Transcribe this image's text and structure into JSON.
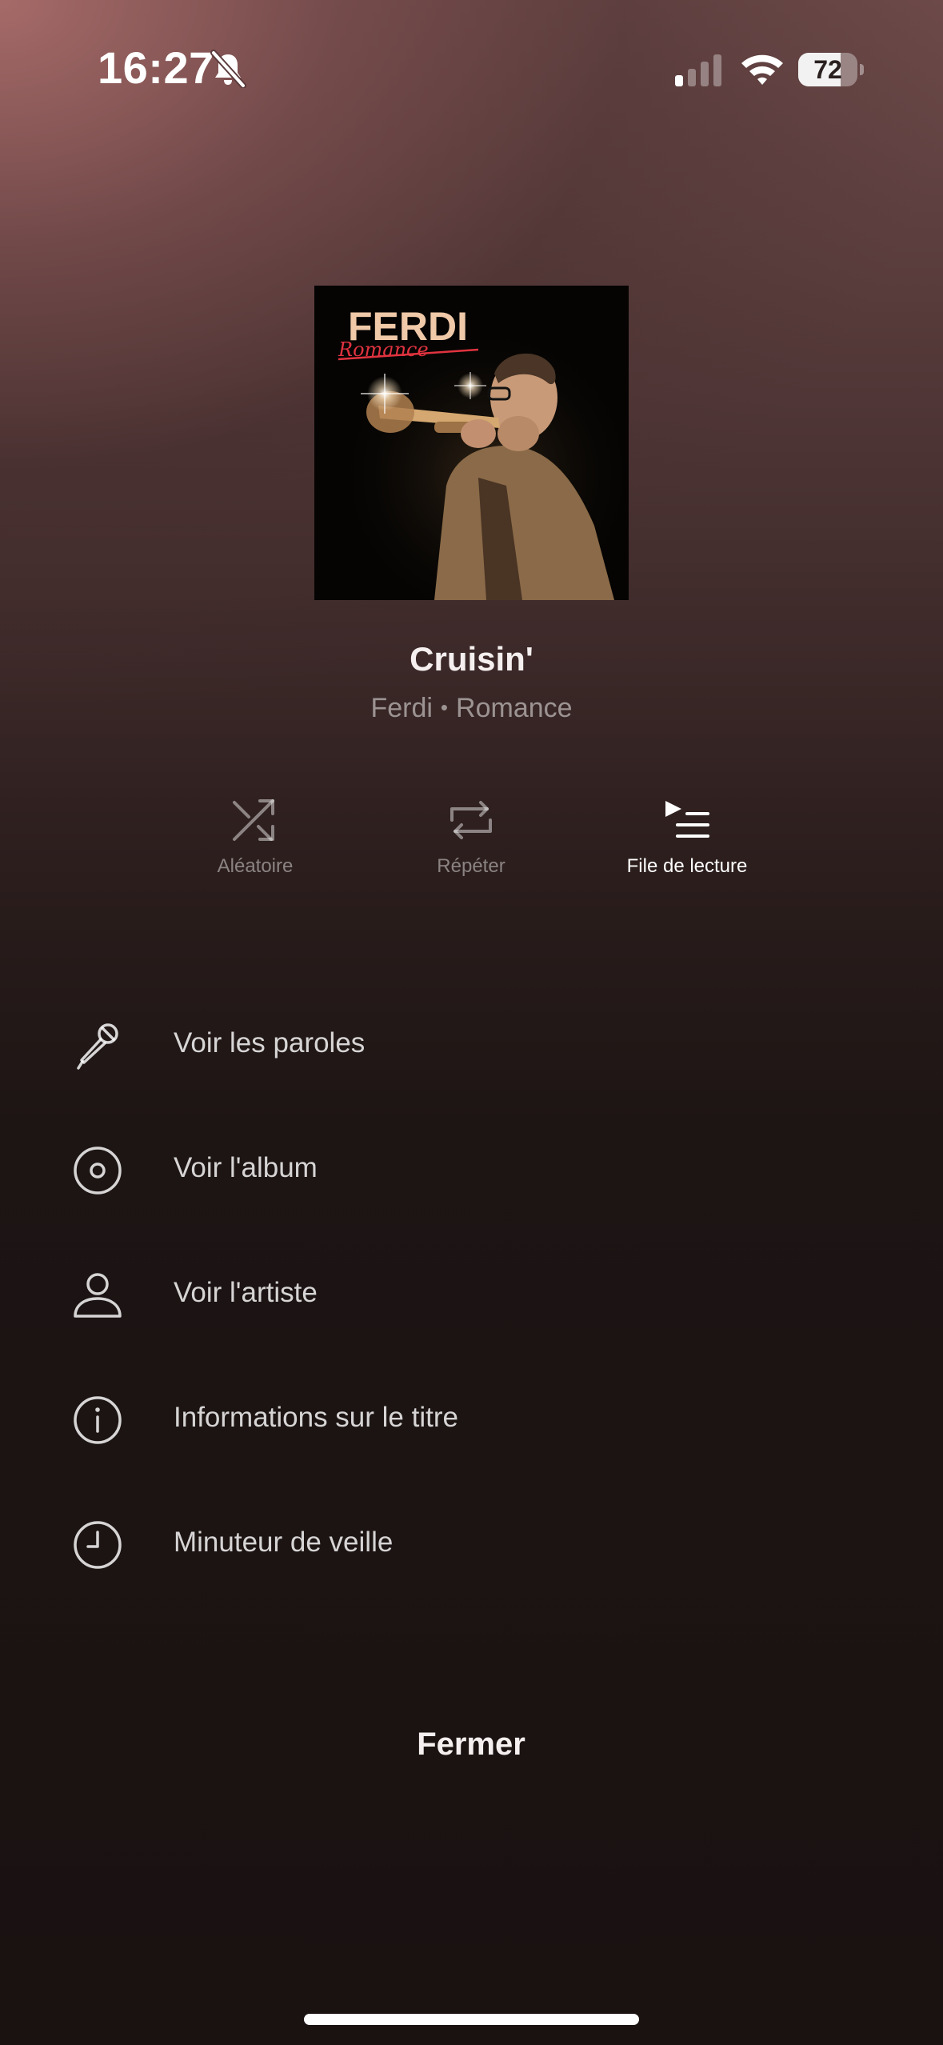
{
  "status_bar": {
    "time": "16:27",
    "battery_level": "72",
    "battery_fraction": 0.72,
    "icons": [
      "bell-slash-icon",
      "cellular-signal-icon",
      "wifi-icon",
      "battery-icon"
    ]
  },
  "now_playing": {
    "album_cover_text": "FERDI",
    "album_cover_script": "Romance",
    "title": "Cruisin'",
    "artist": "Ferdi",
    "separator": "•",
    "album": "Romance"
  },
  "playback_options": [
    {
      "label": "Aléatoire",
      "icon": "shuffle-icon",
      "active": false
    },
    {
      "label": "Répéter",
      "icon": "repeat-icon",
      "active": false
    },
    {
      "label": "File de lecture",
      "icon": "queue-icon",
      "active": true
    }
  ],
  "menu": [
    {
      "label": "Voir les paroles",
      "icon": "microphone-icon"
    },
    {
      "label": "Voir l'album",
      "icon": "album-disc-icon"
    },
    {
      "label": "Voir l'artiste",
      "icon": "person-icon"
    },
    {
      "label": "Informations sur le titre",
      "icon": "info-icon"
    },
    {
      "label": "Minuteur de veille",
      "icon": "clock-icon"
    }
  ],
  "close_label": "Fermer",
  "colors": {
    "accent_red": "#e0333f",
    "cover_title": "#f0c9a8",
    "inactive_option": "#8f8584"
  }
}
